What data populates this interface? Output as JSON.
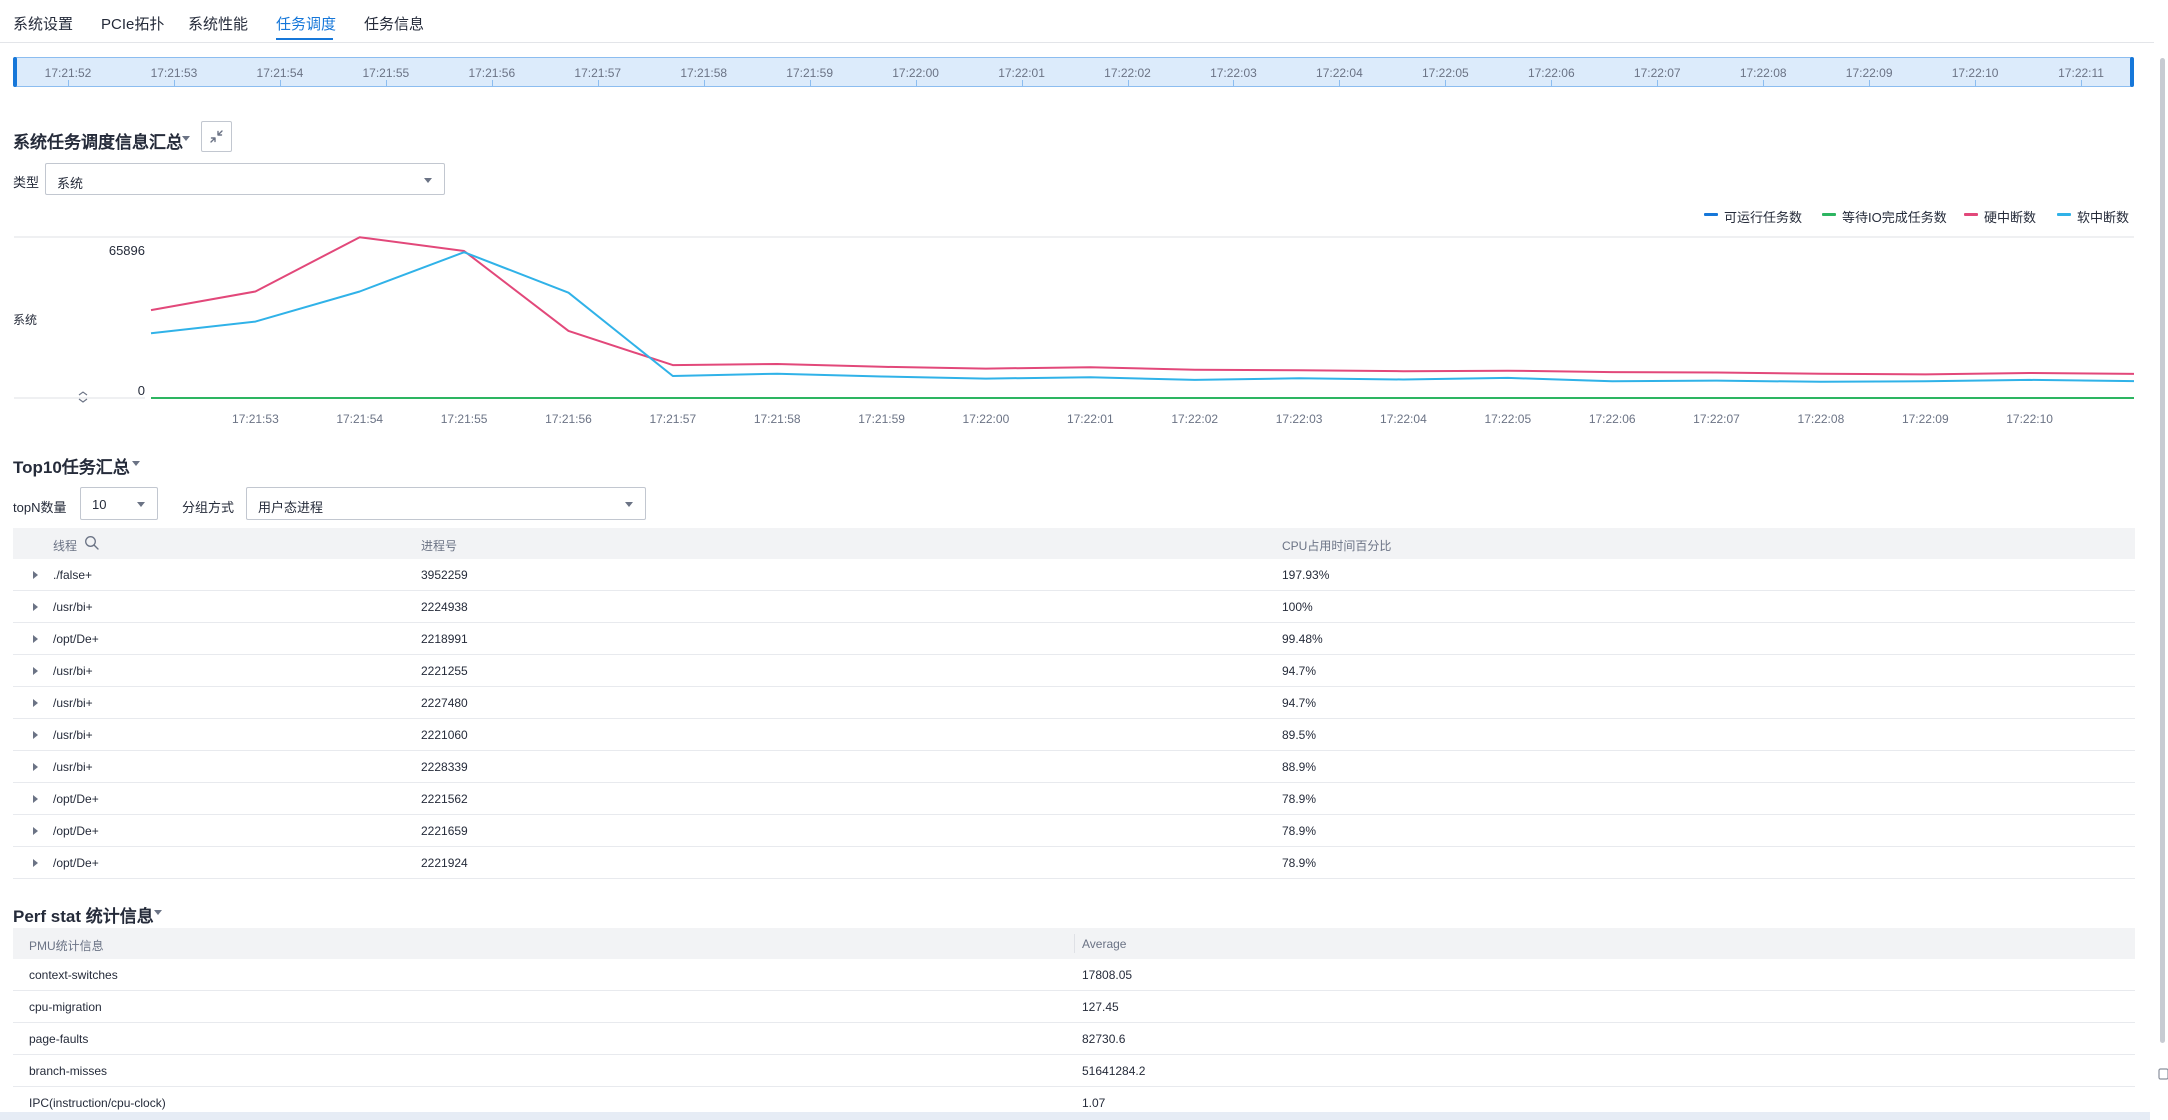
{
  "tabs": [
    {
      "label": "系统设置"
    },
    {
      "label": "PCIe拓扑"
    },
    {
      "label": "系统性能"
    },
    {
      "label": "任务调度"
    },
    {
      "label": "任务信息"
    }
  ],
  "active_tab": "任务调度",
  "timeline": {
    "labels": [
      "17:21:52",
      "17:21:53",
      "17:21:54",
      "17:21:55",
      "17:21:56",
      "17:21:57",
      "17:21:58",
      "17:21:59",
      "17:22:00",
      "17:22:01",
      "17:22:02",
      "17:22:03",
      "17:22:04",
      "17:22:05",
      "17:22:06",
      "17:22:07",
      "17:22:08",
      "17:22:09",
      "17:22:10",
      "17:22:11"
    ]
  },
  "sched_summary": {
    "title": "系统任务调度信息汇总",
    "type_label": "类型",
    "type_value": "系统",
    "collapse_icon": "compress-arrows-icon"
  },
  "chart_data": {
    "type": "line",
    "ylabel": "系统",
    "y_tick_labels": [
      "65896",
      "0"
    ],
    "ylim": [
      0,
      70000
    ],
    "grid": false,
    "legend_position": "top-right",
    "x": [
      "17:21:52",
      "17:21:53",
      "17:21:54",
      "17:21:55",
      "17:21:56",
      "17:21:57",
      "17:21:58",
      "17:21:59",
      "17:22:00",
      "17:22:01",
      "17:22:02",
      "17:22:03",
      "17:22:04",
      "17:22:05",
      "17:22:06",
      "17:22:07",
      "17:22:08",
      "17:22:09",
      "17:22:10",
      "17:22:11"
    ],
    "x_tick_labels": [
      "17:21:53",
      "17:21:54",
      "17:21:55",
      "17:21:56",
      "17:21:57",
      "17:21:58",
      "17:21:59",
      "17:22:00",
      "17:22:01",
      "17:22:02",
      "17:22:03",
      "17:22:04",
      "17:22:05",
      "17:22:06",
      "17:22:07",
      "17:22:08",
      "17:22:09",
      "17:22:10"
    ],
    "series": [
      {
        "name": "可运行任务数",
        "color": "#1677d9",
        "values": [
          0,
          0,
          0,
          0,
          0,
          0,
          0,
          0,
          0,
          0,
          0,
          0,
          0,
          0,
          0,
          0,
          0,
          0,
          0,
          0
        ]
      },
      {
        "name": "等待IO完成任务数",
        "color": "#2db561",
        "values": [
          0,
          0,
          0,
          0,
          0,
          0,
          0,
          0,
          0,
          0,
          0,
          0,
          0,
          0,
          0,
          0,
          0,
          0,
          0,
          0
        ]
      },
      {
        "name": "硬中断数",
        "color": "#e2487a",
        "values": [
          38000,
          46000,
          69500,
          63500,
          29000,
          14200,
          14700,
          13500,
          12700,
          13300,
          12200,
          12000,
          11600,
          11800,
          11200,
          11000,
          10500,
          10200,
          10800,
          10400
        ]
      },
      {
        "name": "软中断数",
        "color": "#30b2e8",
        "values": [
          28000,
          33000,
          46000,
          63000,
          45500,
          9500,
          10500,
          9300,
          8400,
          9000,
          7800,
          8500,
          8000,
          8700,
          7200,
          7500,
          7000,
          7200,
          7800,
          7300
        ]
      }
    ]
  },
  "top10": {
    "title": "Top10任务汇总",
    "topn_label": "topN数量",
    "topn_value": "10",
    "group_label": "分组方式",
    "group_value": "用户态进程",
    "columns": [
      "线程",
      "进程号",
      "CPU占用时间百分比"
    ],
    "rows": [
      {
        "thread": "./false+",
        "pid": "3952259",
        "cpu": "197.93%"
      },
      {
        "thread": "/usr/bi+",
        "pid": "2224938",
        "cpu": "100%"
      },
      {
        "thread": "/opt/De+",
        "pid": "2218991",
        "cpu": "99.48%"
      },
      {
        "thread": "/usr/bi+",
        "pid": "2221255",
        "cpu": "94.7%"
      },
      {
        "thread": "/usr/bi+",
        "pid": "2227480",
        "cpu": "94.7%"
      },
      {
        "thread": "/usr/bi+",
        "pid": "2221060",
        "cpu": "89.5%"
      },
      {
        "thread": "/usr/bi+",
        "pid": "2228339",
        "cpu": "88.9%"
      },
      {
        "thread": "/opt/De+",
        "pid": "2221562",
        "cpu": "78.9%"
      },
      {
        "thread": "/opt/De+",
        "pid": "2221659",
        "cpu": "78.9%"
      },
      {
        "thread": "/opt/De+",
        "pid": "2221924",
        "cpu": "78.9%"
      }
    ]
  },
  "perf": {
    "title": "Perf stat 统计信息",
    "columns": [
      "PMU统计信息",
      "Average"
    ],
    "rows": [
      {
        "name": "context-switches",
        "avg": "17808.05"
      },
      {
        "name": "cpu-migration",
        "avg": "127.45"
      },
      {
        "name": "page-faults",
        "avg": "82730.6"
      },
      {
        "name": "branch-misses",
        "avg": "51641284.2"
      },
      {
        "name": "IPC(instruction/cpu-clock)",
        "avg": "1.07"
      }
    ]
  },
  "colors": {
    "accent": "#1677d9",
    "timeline_fill": "#dcebfb"
  }
}
